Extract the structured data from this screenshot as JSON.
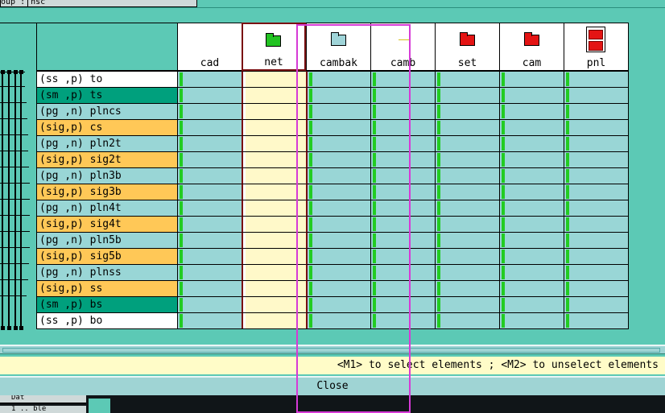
{
  "top_field": {
    "left_text": "oup :",
    "right_text": "nsc"
  },
  "columns": [
    {
      "name": "cad",
      "icon": "none",
      "selected": false
    },
    {
      "name": "net",
      "icon": "green-folder-icon",
      "selected": true
    },
    {
      "name": "cambak",
      "icon": "teal-folder-icon",
      "selected": false
    },
    {
      "name": "camb",
      "icon": "dash-icon",
      "selected": false
    },
    {
      "name": "set",
      "icon": "red-folder-icon",
      "selected": false
    },
    {
      "name": "cam",
      "icon": "red-folder-icon",
      "selected": false
    },
    {
      "name": "pnl",
      "icon": "red-stack-icon",
      "selected": false
    }
  ],
  "layers": [
    {
      "label": "(ss ,p) to",
      "type": "ss"
    },
    {
      "label": "(sm ,p) ts",
      "type": "sm"
    },
    {
      "label": "(pg ,n) plncs",
      "type": "pg"
    },
    {
      "label": "(sig,p) cs",
      "type": "sig"
    },
    {
      "label": "(pg ,n) pln2t",
      "type": "pg"
    },
    {
      "label": "(sig,p) sig2t",
      "type": "sig"
    },
    {
      "label": "(pg ,n) pln3b",
      "type": "pg"
    },
    {
      "label": "(sig,p) sig3b",
      "type": "sig"
    },
    {
      "label": "(pg ,n) pln4t",
      "type": "pg"
    },
    {
      "label": "(sig,p) sig4t",
      "type": "sig"
    },
    {
      "label": "(pg ,n) pln5b",
      "type": "pg"
    },
    {
      "label": "(sig,p) sig5b",
      "type": "sig"
    },
    {
      "label": "(pg ,n) plnss",
      "type": "pg"
    },
    {
      "label": "(sig,p) ss",
      "type": "sig"
    },
    {
      "label": "(sm ,p) bs",
      "type": "sm"
    },
    {
      "label": "(ss ,p) bo",
      "type": "ss"
    }
  ],
  "colors": {
    "background": "#5cc9b5",
    "cell": "#99d6d6",
    "selected_cell": "#fff9c9",
    "sig_row": "#ffc857",
    "sm_row": "#00a07d",
    "ss_row": "#ffffff",
    "pg_row": "#99d6d6",
    "enabled_mark": "#22cc22",
    "highlight_box": "#d63ad6"
  },
  "status": {
    "message": "<M1> to select elements ; <M2> to unselect elements"
  },
  "actions": {
    "close_label": "Close"
  },
  "bottom": {
    "item1": "Dat",
    "item2": "1 .. ble"
  }
}
